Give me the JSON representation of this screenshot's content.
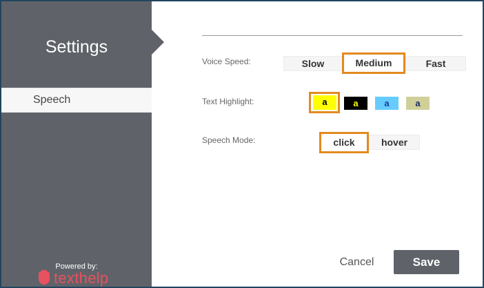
{
  "sidebar": {
    "title": "Settings",
    "active_item": "Speech",
    "powered_by": "Powered by:",
    "brand": "texthelp"
  },
  "voice_speed": {
    "label": "Voice Speed:",
    "options": [
      "Slow",
      "Medium",
      "Fast"
    ],
    "selected": "Medium"
  },
  "text_highlight": {
    "label": "Text Highlight:",
    "options": [
      {
        "text": "a",
        "bg": "#ffff00",
        "fg": "#000000"
      },
      {
        "text": "a",
        "bg": "#000000",
        "fg": "#ffff00"
      },
      {
        "text": "a",
        "bg": "#66ccff",
        "fg": "#1a3e9a"
      },
      {
        "text": "a",
        "bg": "#cfcf9a",
        "fg": "#1a2a6a"
      }
    ],
    "selected_index": 0
  },
  "speech_mode": {
    "label": "Speech Mode:",
    "options": [
      "click",
      "hover"
    ],
    "selected": "click"
  },
  "actions": {
    "cancel_label": "Cancel",
    "save_label": "Save"
  },
  "colors": {
    "sidebar_bg": "#5f6369",
    "accent_orange": "#e38a1f",
    "brand_red": "#e8515f",
    "frame_border": "#22455e"
  }
}
